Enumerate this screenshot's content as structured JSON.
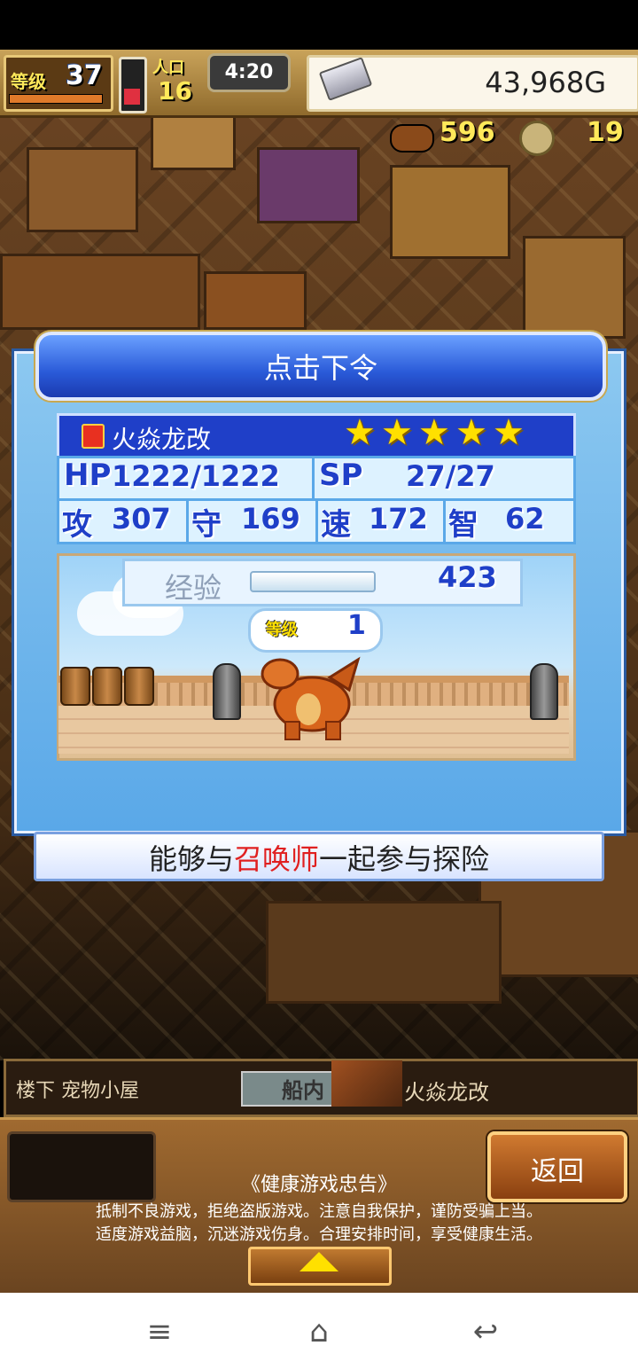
{
  "hud": {
    "level_label": "等级",
    "level": "37",
    "people_label": "人口",
    "people": "16",
    "clock": "4:20",
    "gold": "43,968G",
    "food": "596",
    "medals": "19"
  },
  "dialog": {
    "title": "点击下令",
    "monster_name": "火焱龙改",
    "stars": [
      "★",
      "★",
      "★",
      "★",
      "★"
    ],
    "stats": {
      "hp_label": "HP",
      "hp": "1222/1222",
      "sp_label": "SP",
      "sp": "27/27",
      "atk_label": "攻",
      "atk": "307",
      "def_label": "守",
      "def": "169",
      "spd_label": "速",
      "spd": "172",
      "int_label": "智",
      "int": "62"
    },
    "exp_label": "经验",
    "exp": "423",
    "level_label": "等级",
    "level": "1",
    "description_before": "能够与",
    "description_highlight": "召唤师",
    "description_after": "一起参与探险"
  },
  "location": {
    "area": "楼下 宠物小屋",
    "ship_label": "船内",
    "pet_name": "火焱龙改"
  },
  "footer": {
    "back_label": "返回",
    "notice_title": "《健康游戏忠告》",
    "notice_line1": "抵制不良游戏，拒绝盗版游戏。注意自我保护，谨防受骗上当。",
    "notice_line2": "适度游戏益脑，沉迷游戏伤身。合理安排时间，享受健康生活。"
  },
  "navbar": {
    "menu_icon": "≡",
    "home_icon": "⌂",
    "back_icon": "↩"
  }
}
